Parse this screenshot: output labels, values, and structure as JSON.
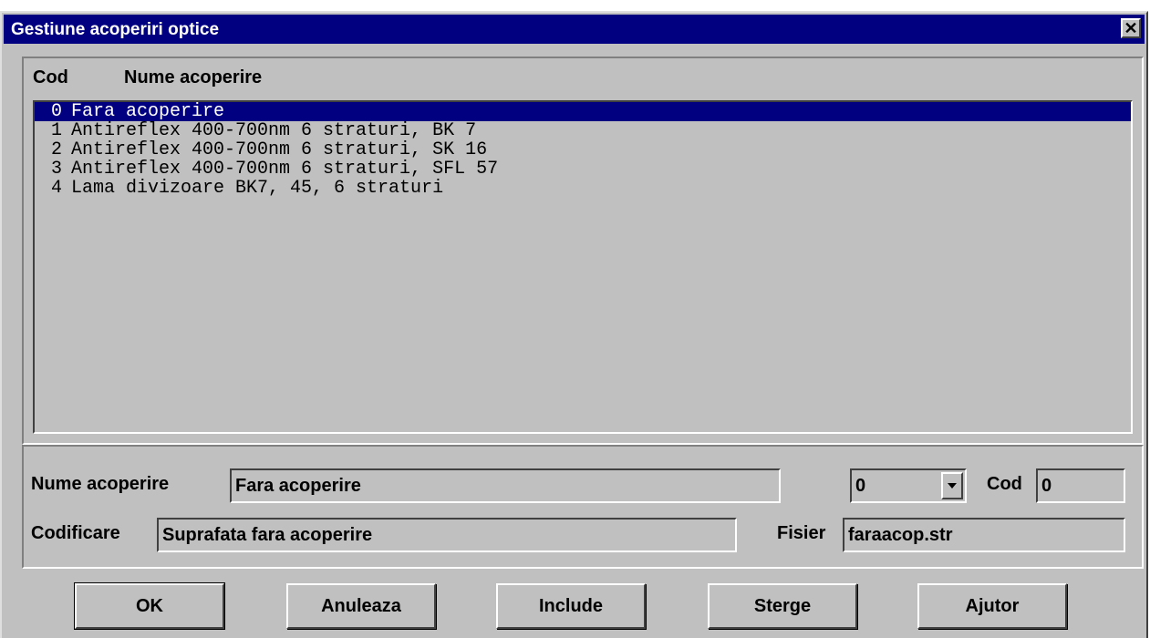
{
  "window": {
    "title": "Gestiune acoperiri optice",
    "close_glyph": "✕"
  },
  "list": {
    "header_code": "Cod",
    "header_name": "Nume acoperire",
    "selected_index": 0,
    "items": [
      {
        "code": "0",
        "name": "Fara acoperire"
      },
      {
        "code": "1",
        "name": "Antireflex 400-700nm 6 straturi, BK 7"
      },
      {
        "code": "2",
        "name": "Antireflex 400-700nm 6 straturi, SK 16"
      },
      {
        "code": "3",
        "name": "Antireflex 400-700nm 6 straturi, SFL 57"
      },
      {
        "code": "4",
        "name": "Lama divizoare BK7, 45, 6 straturi"
      }
    ]
  },
  "form": {
    "nume_label": "Nume acoperire",
    "nume_value": "Fara acoperire",
    "combo_value": "0",
    "cod_label": "Cod",
    "cod_value": "0",
    "codificare_label": "Codificare",
    "codificare_value": "Suprafata fara acoperire",
    "fisier_label": "Fisier",
    "fisier_value": "faraacop.str"
  },
  "buttons": {
    "ok": "OK",
    "anuleaza": "Anuleaza",
    "include": "Include",
    "sterge": "Sterge",
    "ajutor": "Ajutor"
  },
  "colors": {
    "titlebar": "#000080",
    "face": "#c0c0c0",
    "selection": "#000080"
  }
}
